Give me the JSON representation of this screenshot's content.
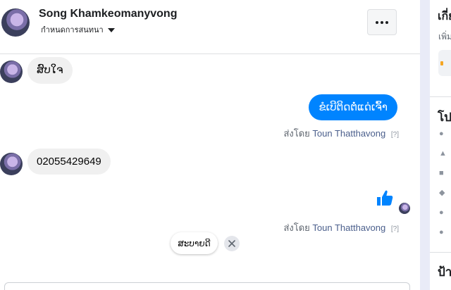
{
  "header": {
    "contact_name": "Song Khamkeomanyvong",
    "set_nickname": "กำหนดการสนทนา"
  },
  "messages": {
    "m1": "ສົບໃຈ",
    "m2": "ຂໍເບີຕິດຕໍ່ແດ່ເຈົ້າ",
    "m3": "02055429649"
  },
  "sent_by": {
    "prefix": "ส่งโดย",
    "name": "Toun Thatthavong",
    "help": "[?]"
  },
  "quick_reply": "ສະບາຍດີ",
  "side": {
    "title1": "เกี่ยวกับ",
    "subtitle": "เพิ่ม",
    "title2": "โปรไฟล์",
    "title3": "ป้าย"
  },
  "colors": {
    "messenger_blue": "#0084ff",
    "incoming_bubble": "#f0f0f0",
    "divider_bg": "#e9ebf7"
  }
}
